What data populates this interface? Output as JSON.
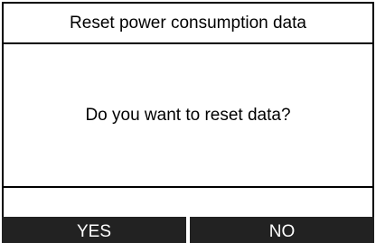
{
  "dialog": {
    "title": "Reset power consumption data",
    "message": "Do you want to reset data?"
  },
  "soft_keys": {
    "yes_label": "YES",
    "no_label": "NO"
  },
  "colors": {
    "background": "#ffffff",
    "border": "#000000",
    "soft_key_background": "#222222",
    "soft_key_text": "#ffffff"
  }
}
